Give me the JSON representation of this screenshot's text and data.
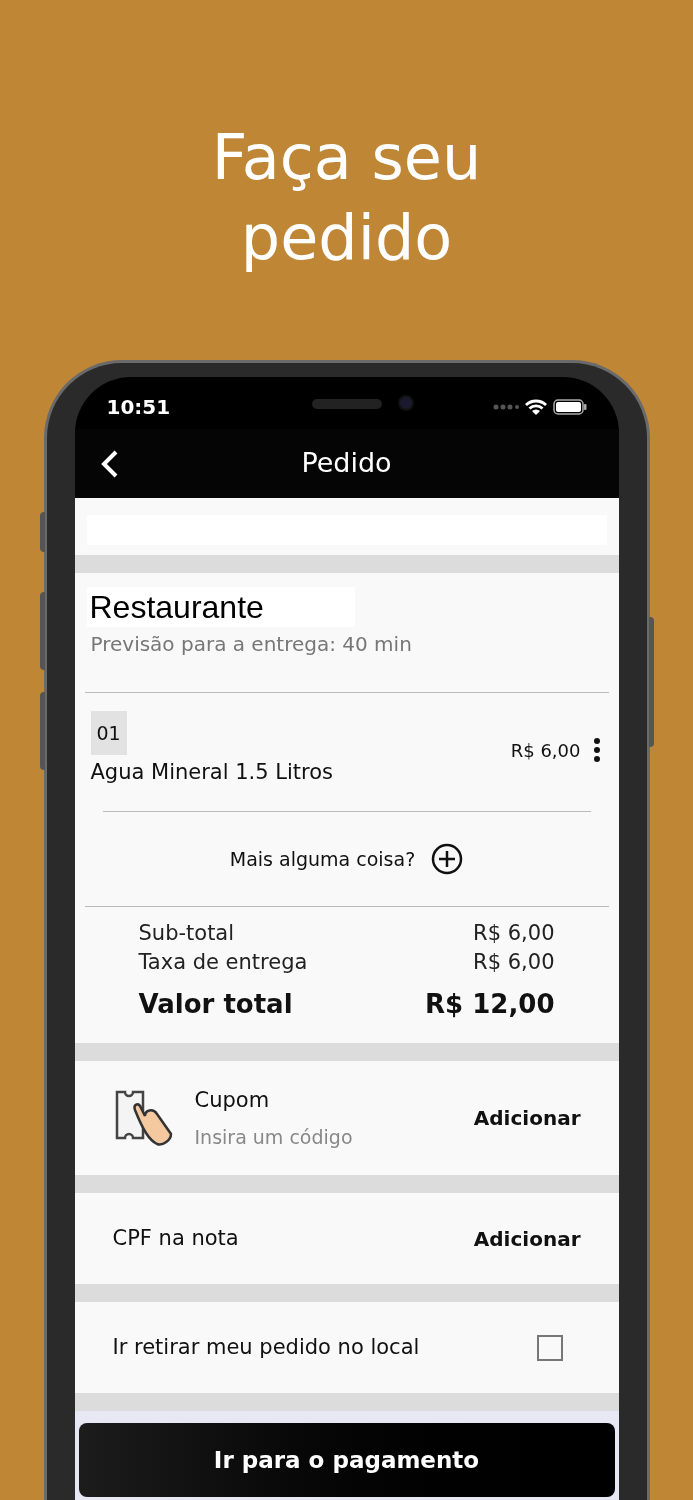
{
  "headline": "Faça seu pedido",
  "status_bar": {
    "time": "10:51"
  },
  "header": {
    "title": "Pedido"
  },
  "restaurant": {
    "name": "Restaurante",
    "estimate": "Previsão para a entrega: 40 min"
  },
  "items": [
    {
      "quantity": "01",
      "name": "Agua Mineral 1.5 Litros",
      "price": "R$ 6,00"
    }
  ],
  "add_more": {
    "label": "Mais alguma coisa?"
  },
  "totals": [
    {
      "kind": "normal",
      "label": "Sub-total",
      "value": "R$ 6,00"
    },
    {
      "kind": "normal",
      "label": "Taxa de entrega",
      "value": "R$ 6,00"
    },
    {
      "kind": "total",
      "label": "Valor total",
      "value": "R$ 12,00"
    }
  ],
  "coupon": {
    "title": "Cupom",
    "subtitle": "Insira um código",
    "action": "Adicionar"
  },
  "cpf": {
    "label": "CPF na nota",
    "action": "Adicionar"
  },
  "pickup": {
    "label": "Ir retirar meu pedido no local",
    "checked": false
  },
  "button": {
    "label": "Ir para o pagamento"
  }
}
